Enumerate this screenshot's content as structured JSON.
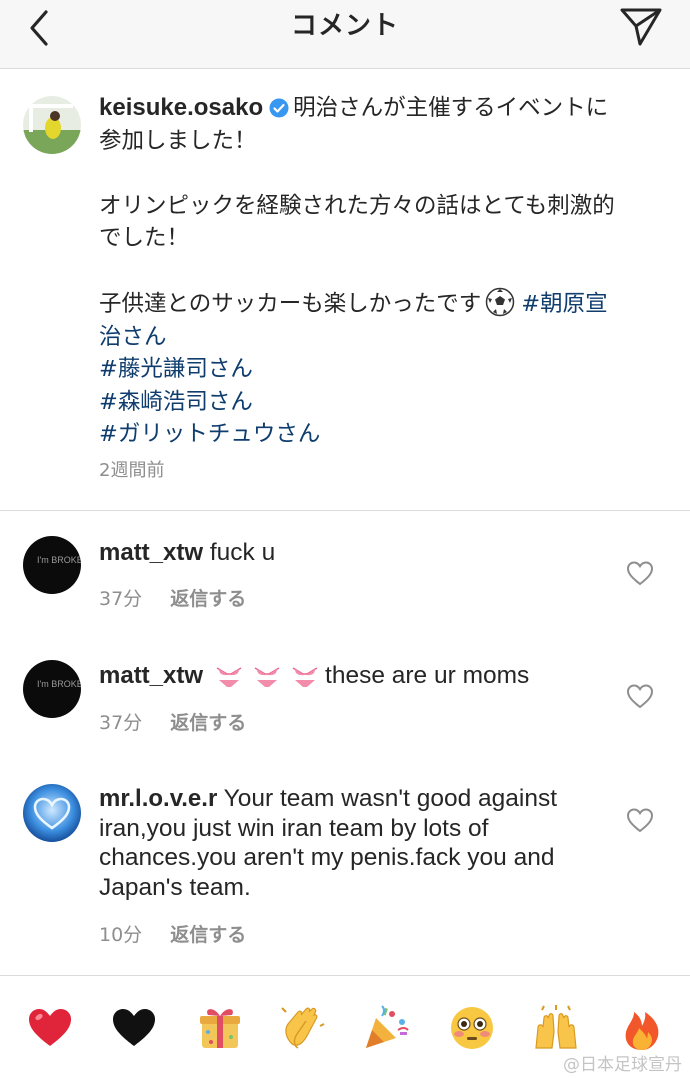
{
  "header": {
    "title": "コメント",
    "back_icon": "chevron-left-icon",
    "send_icon": "paper-plane-icon"
  },
  "post": {
    "username": "keisuke.osako",
    "verified": true,
    "caption_line1": "明治さんが主催するイベントに参加しました！",
    "caption_line2": "オリンピックを経験された方々の話はとても刺激的でした！",
    "caption_line3": "子供達とのサッカーも楽しかったです",
    "caption_emoji": "soccer-ball-icon",
    "hashtags": [
      "#朝原宣治さん",
      "#藤光謙司さん",
      "#森崎浩司さん",
      "#ガリットチュウさん"
    ],
    "time": "2週間前"
  },
  "comments": [
    {
      "username": "matt_xtw",
      "text": "fuck u",
      "time": "37分",
      "reply_label": "返信する",
      "avatar_text": "I'm BROKEN"
    },
    {
      "username": "matt_xtw",
      "emojis": [
        "bikini-icon",
        "bikini-icon",
        "bikini-icon"
      ],
      "text": "these are ur moms",
      "time": "37分",
      "reply_label": "返信する",
      "avatar_text": "I'm BROKEN"
    },
    {
      "username": "mr.l.o.v.e.r",
      "text": "Your team wasn't good against iran,you just win iran team by lots of chances.you aren't my penis.fack you and Japan's team.",
      "time": "10分",
      "reply_label": "返信する",
      "avatar_icon": "blue-heart-icon"
    }
  ],
  "emoji_bar": [
    "red-heart-icon",
    "black-heart-icon",
    "wrapped-gift-icon",
    "clapping-hands-icon",
    "party-popper-icon",
    "flushed-face-icon",
    "raising-hands-icon",
    "fire-icon"
  ],
  "watermark": "@日本足球宣丹",
  "colors": {
    "hashtag": "#0f3d6e",
    "verified": "#3897f0",
    "muted": "#8e8e8e"
  }
}
